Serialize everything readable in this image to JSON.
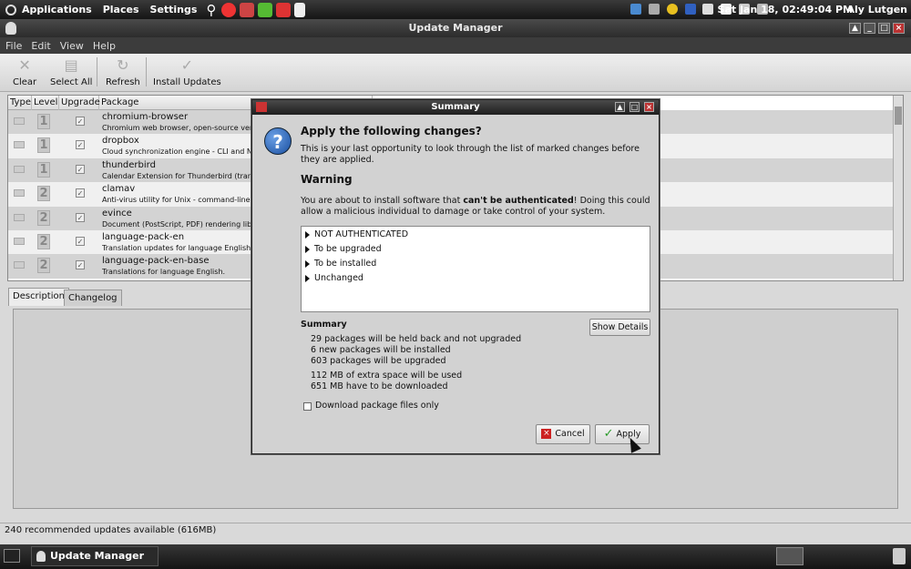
{
  "top_panel": {
    "menus": [
      "Applications",
      "Places",
      "Settings"
    ],
    "clock": "Sat Jan 18, 02:49:04 PM",
    "user": "Aly Lutgen"
  },
  "window": {
    "title": "Update Manager",
    "menu": [
      "File",
      "Edit",
      "View",
      "Help"
    ],
    "toolbar": {
      "clear": "Clear",
      "select_all": "Select All",
      "refresh": "Refresh",
      "install": "Install Updates"
    },
    "columns": [
      "Type",
      "Level",
      "Upgrade",
      "Package"
    ],
    "rows": [
      {
        "level": "1",
        "name": "chromium-browser",
        "desc": "Chromium web browser, open-source ver"
      },
      {
        "level": "1",
        "name": "dropbox",
        "desc": "Cloud synchronization engine - CLI and N"
      },
      {
        "level": "1",
        "name": "thunderbird",
        "desc": "Calendar Extension for Thunderbird (tran"
      },
      {
        "level": "2",
        "name": "clamav",
        "desc": "Anti-virus utility for Unix - command-line"
      },
      {
        "level": "2",
        "name": "evince",
        "desc": "Document (PostScript, PDF) rendering libr"
      },
      {
        "level": "2",
        "name": "language-pack-en",
        "desc": "Translation updates for language English."
      },
      {
        "level": "2",
        "name": "language-pack-en-base",
        "desc": "Translations for language English."
      }
    ],
    "tabs": [
      "Description",
      "Changelog"
    ],
    "status": "240 recommended updates available (616MB)"
  },
  "taskbar": {
    "task": "Update Manager"
  },
  "dialog": {
    "title": "Summary",
    "heading": "Apply the following changes?",
    "intro": "This is your last opportunity to look through the list of marked changes before they are applied.",
    "warning_title": "Warning",
    "warning_pre": "You are about to install software that ",
    "warning_bold": "can't be authenticated",
    "warning_post": "! Doing this could allow a malicious individual to damage or take control of your system.",
    "tree": [
      "NOT AUTHENTICATED",
      "To be upgraded",
      "To be installed",
      "Unchanged"
    ],
    "summary_title": "Summary",
    "show_details": "Show Details",
    "summary_lines": [
      "29 packages will be held back and not upgraded",
      "6 new packages will be installed",
      "603 packages will be upgraded"
    ],
    "space_lines": [
      "112 MB of extra space will be used",
      "651 MB have to be downloaded"
    ],
    "download_only": "Download package files only",
    "cancel": "Cancel",
    "apply": "Apply"
  }
}
